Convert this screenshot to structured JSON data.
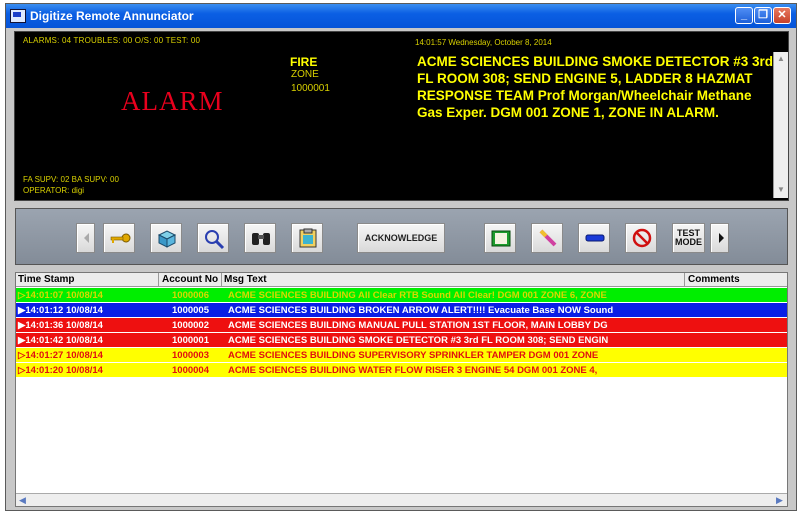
{
  "window": {
    "title": "Digitize Remote Annunciator"
  },
  "panel": {
    "counts": "ALARMS: 04   TROUBLES: 00   O/S: 00   TEST: 00",
    "alarm_word": "ALARM",
    "event_type": "FIRE",
    "zone_label": "ZONE",
    "zone_number": "1000001",
    "datetime": "14:01:57 Wednesday, October 8, 2014",
    "message": "ACME SCIENCES BUILDING SMOKE DETECTOR #3 3rd FL ROOM 308; SEND ENGINE 5, LADDER 8 HAZMAT RESPONSE TEAM Prof Morgan/Wheelchair Methane Gas Exper. DGM 001 ZONE 1, ZONE IN ALARM.",
    "supv": "FA SUPV: 02   BA SUPV: 00",
    "operator": "OPERATOR: digi"
  },
  "toolbar": {
    "acknowledge_label": "ACKNOWLEDGE",
    "test_label_1": "TEST",
    "test_label_2": "MODE"
  },
  "grid": {
    "columns": [
      "Time Stamp",
      "Account No",
      "Msg Text",
      "Comments"
    ],
    "rows": [
      {
        "time": "14:01:07 10/08/14",
        "account": "1000006",
        "text": "ACME SCIENCES BUILDING  All Clear RTB Sound All Clear!  DGM 001 ZONE 6, ZONE",
        "bg": "#00ee00",
        "fg": "#d8d800",
        "marker": "▷"
      },
      {
        "time": "14:01:12 10/08/14",
        "account": "1000005",
        "text": "ACME SCIENCES BUILDING  BROKEN ARROW ALERT!!!! Evacuate Base NOW Sound",
        "bg": "#0a1ee6",
        "fg": "#ffffff",
        "marker": "▶"
      },
      {
        "time": "14:01:36 10/08/14",
        "account": "1000002",
        "text": "ACME SCIENCES BUILDING  MANUAL PULL STATION 1ST FLOOR, MAIN LOBBY  DG",
        "bg": "#ee1010",
        "fg": "#ffffff",
        "marker": "▶"
      },
      {
        "time": "14:01:42 10/08/14",
        "account": "1000001",
        "text": "ACME SCIENCES BUILDING  SMOKE DETECTOR #3 3rd FL ROOM 308; SEND ENGIN",
        "bg": "#ee1010",
        "fg": "#ffffff",
        "marker": "▶"
      },
      {
        "time": "14:01:27 10/08/14",
        "account": "1000003",
        "text": "ACME SCIENCES BUILDING  SUPERVISORY SPRINKLER TAMPER  DGM 001 ZONE",
        "bg": "#ffff00",
        "fg": "#e01010",
        "marker": "▷"
      },
      {
        "time": "14:01:20 10/08/14",
        "account": "1000004",
        "text": "ACME SCIENCES BUILDING  WATER FLOW RISER 3 ENGINE 54  DGM 001 ZONE 4,",
        "bg": "#ffff00",
        "fg": "#e01010",
        "marker": "▷"
      }
    ]
  }
}
